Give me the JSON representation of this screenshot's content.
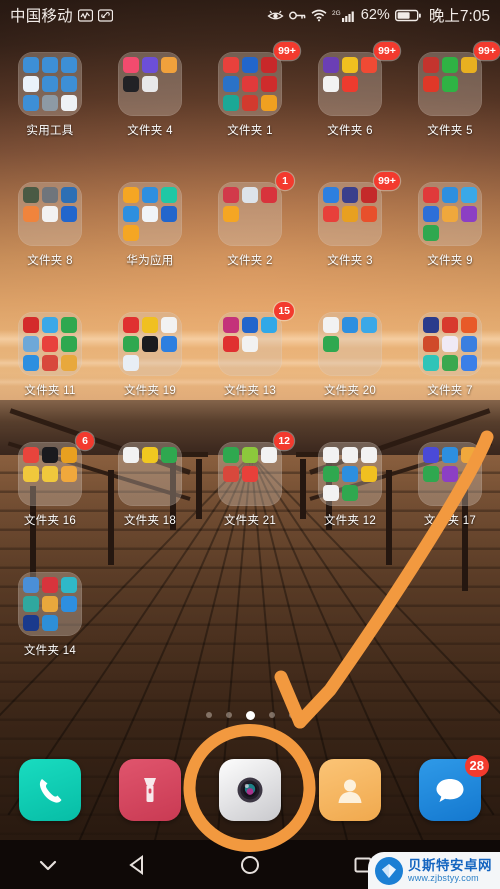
{
  "status_bar": {
    "carrier": "中国移动",
    "icons": [
      "signal-wave-icon",
      "link-icon",
      "eye-care-icon",
      "vpn-key-icon",
      "wifi-icon"
    ],
    "network_type": "2G",
    "battery_percent": "62%",
    "time": "晚上7:05"
  },
  "home_screen": {
    "rows": [
      {
        "cells": [
          {
            "label": "实用工具",
            "badge": "",
            "tiles": [
              "#3d8fd6",
              "#3d8fd6",
              "#3d8fd6",
              "#eaf2fa",
              "#3d8fd6",
              "#3d8fd6",
              "#3d8fd6",
              "#8d9aa5",
              "#eef2f5"
            ]
          },
          {
            "label": "文件夹 4",
            "badge": "",
            "tiles": [
              "#f24b6e",
              "#6c4fd8",
              "#f0a13c",
              "#222226",
              "#e8e8ea",
              "",
              "",
              "",
              ""
            ]
          },
          {
            "label": "文件夹 1",
            "badge": "99+",
            "tiles": [
              "#e8413c",
              "#2266cc",
              "#c8282a",
              "#2a72c8",
              "#e03a3a",
              "#cf2c2c",
              "#1aa896",
              "#d23a2e",
              "#f0a020"
            ]
          },
          {
            "label": "文件夹 6",
            "badge": "99+",
            "tiles": [
              "#6b3fb5",
              "#f0c020",
              "#f04a34",
              "#f2f2f2",
              "#ee3b2e",
              "",
              "",
              "",
              ""
            ]
          },
          {
            "label": "文件夹 5",
            "badge": "99+",
            "tiles": [
              "#c4342e",
              "#2fb344",
              "#e8b020",
              "#e03828",
              "#2fb344",
              "",
              "",
              "",
              ""
            ]
          }
        ]
      },
      {
        "cells": [
          {
            "label": "文件夹 8",
            "badge": "",
            "tiles": [
              "#4a5a44",
              "#6f757c",
              "#2d6fb5",
              "#f0843c",
              "#f2f2f2",
              "#2266cc",
              "",
              "",
              ""
            ]
          },
          {
            "label": "华为应用",
            "badge": "",
            "tiles": [
              "#f5a623",
              "#2d8fe0",
              "#1ec8a5",
              "#2d8fe0",
              "#f0f4f8",
              "#2266cc",
              "#f5a623",
              "",
              ""
            ]
          },
          {
            "label": "文件夹 2",
            "badge": "1",
            "tiles": [
              "#d23a4a",
              "#dde3ea",
              "#d8333c",
              "#f5a623",
              "",
              "",
              "",
              "",
              ""
            ]
          },
          {
            "label": "文件夹 3",
            "badge": "99+",
            "tiles": [
              "#2d7fe0",
              "#3a3f8c",
              "#c42a2a",
              "#e8403a",
              "#e8a020",
              "#e8502c",
              "",
              "",
              ""
            ]
          },
          {
            "label": "文件夹 9",
            "badge": "",
            "tiles": [
              "#e03a3a",
              "#2d8fe0",
              "#3aa8e8",
              "#2d6fd8",
              "#f0a83c",
              "#8c3fc4",
              "#2fa84f",
              "",
              ""
            ]
          }
        ]
      },
      {
        "cells": [
          {
            "label": "文件夹 11",
            "badge": "",
            "tiles": [
              "#d42b2b",
              "#3aa8e8",
              "#2fa84f",
              "#6ea8d8",
              "#e8413c",
              "#2fa84f",
              "#2d8fe0",
              "#d8483c",
              "#e8a83c"
            ]
          },
          {
            "label": "文件夹 19",
            "badge": "",
            "tiles": [
              "#e03030",
              "#f0c020",
              "#f2f2f2",
              "#2fa84f",
              "#1a1a1e",
              "#2d7fe0",
              "#e8eef5",
              "",
              ""
            ]
          },
          {
            "label": "文件夹 13",
            "badge": "15",
            "tiles": [
              "#c4327a",
              "#2266cc",
              "#30a8e8",
              "#e03030",
              "#f2f2f2",
              "",
              "",
              "",
              ""
            ]
          },
          {
            "label": "文件夹 20",
            "badge": "",
            "tiles": [
              "#f2f2f2",
              "#2d8fe0",
              "#3aa8e8",
              "#2fa84f",
              "",
              "",
              "",
              "",
              ""
            ]
          },
          {
            "label": "文件夹 7",
            "badge": "",
            "tiles": [
              "#2a3b8c",
              "#d83a2e",
              "#e85a28",
              "#d04a2a",
              "#f0eaf5",
              "#3a7fe0",
              "#2fc4b8",
              "#3aa84f",
              "#3a7fe8"
            ]
          }
        ]
      },
      {
        "cells": [
          {
            "label": "文件夹 16",
            "badge": "6",
            "tiles": [
              "#e8443c",
              "#1a1a1e",
              "#e8a020",
              "#f0c83c",
              "#f0c83c",
              "#f0a83c",
              "",
              "",
              ""
            ]
          },
          {
            "label": "文件夹 18",
            "badge": "",
            "tiles": [
              "#f2f2f2",
              "#f0c820",
              "#2fa84f",
              "",
              "",
              "",
              "",
              "",
              ""
            ]
          },
          {
            "label": "文件夹 21",
            "badge": "12",
            "tiles": [
              "#2fa84f",
              "#8cc83c",
              "#f2f2f2",
              "#d8483c",
              "#e8403a",
              "",
              "",
              "",
              ""
            ]
          },
          {
            "label": "文件夹 12",
            "badge": "",
            "tiles": [
              "#f2f2f2",
              "#f2f2f2",
              "#f2f2f2",
              "#2fa84f",
              "#2d8fe0",
              "#f0c020",
              "#f2f2f2",
              "#2fa84f",
              ""
            ]
          },
          {
            "label": "文件夹 17",
            "badge": "",
            "tiles": [
              "#4a4ad8",
              "#2d8fe0",
              "#f0a83c",
              "#2fa84f",
              "#8c3fc4",
              "",
              "",
              "",
              ""
            ]
          }
        ]
      },
      {
        "cells": [
          {
            "label": "文件夹 14",
            "badge": "",
            "tiles": [
              "#4a8fd8",
              "#d8343c",
              "#2fb8c8",
              "#2fa89f",
              "#e8a83c",
              "#2d8fe0",
              "#1a3a8c",
              "#2d8fd8",
              ""
            ]
          }
        ]
      }
    ],
    "page_dots": {
      "count": 5,
      "active_index": 2
    }
  },
  "dock": {
    "items": [
      {
        "name": "phone-app",
        "label": "电话",
        "badge": "",
        "color": "#0ed1b5"
      },
      {
        "name": "torch-app",
        "label": "手电筒",
        "badge": "",
        "color": "#d8475e"
      },
      {
        "name": "camera-app",
        "label": "相机",
        "badge": "",
        "color": "#e8e8ea"
      },
      {
        "name": "contacts-app",
        "label": "联系人",
        "badge": "",
        "color": "#f6b košt"
      },
      {
        "name": "messages-app",
        "label": "信息",
        "badge": "28",
        "color": "#1f8fe0"
      }
    ]
  },
  "nav_bar": {
    "buttons": [
      "hide-navbar-icon",
      "back-icon",
      "home-icon",
      "recents-icon"
    ]
  },
  "annotations": {
    "arrow": {
      "name": "orange-arrow",
      "color": "#f2993f"
    },
    "circle": {
      "name": "orange-highlight-circle",
      "target": "camera-app",
      "color": "#f2993f"
    }
  },
  "watermark": {
    "title": "贝斯特安卓网",
    "url": "www.zjbstyy.com"
  }
}
